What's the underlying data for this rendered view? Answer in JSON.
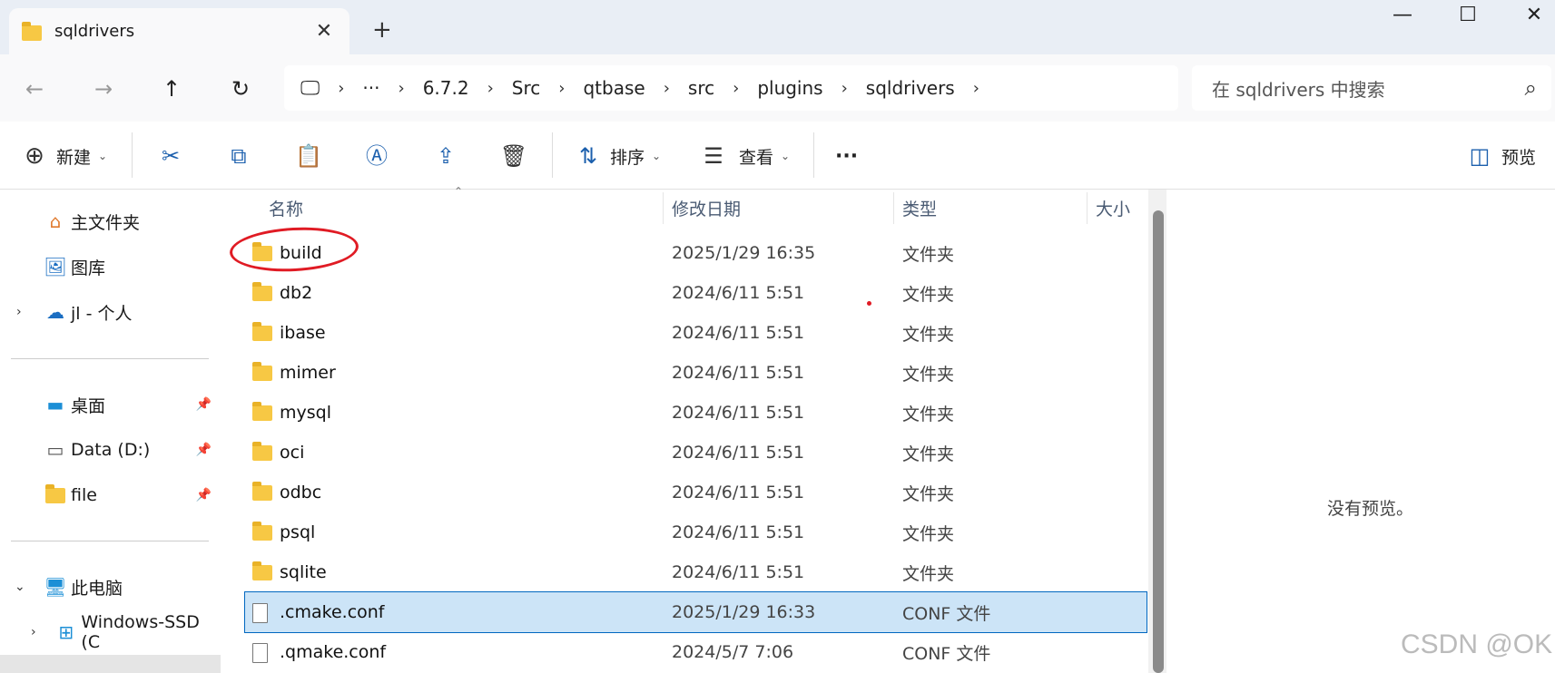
{
  "tab": {
    "title": "sqldrivers",
    "close": "✕",
    "new": "+"
  },
  "window": {
    "minimize": "—",
    "maximize": "☐",
    "close": "✕"
  },
  "nav": {
    "back": "←",
    "forward": "→",
    "up": "↑",
    "refresh": "↻"
  },
  "address": {
    "root_icon": "🖵",
    "ellipsis": "···",
    "sep": "›",
    "crumbs": [
      "6.7.2",
      "Src",
      "qtbase",
      "src",
      "plugins",
      "sqldrivers"
    ]
  },
  "search": {
    "placeholder": "在 sqldrivers 中搜索",
    "icon": "⌕"
  },
  "toolbar": {
    "new_label": "新建",
    "sort_label": "排序",
    "view_label": "查看",
    "more": "···",
    "preview_label": "预览"
  },
  "sidebar": {
    "items": [
      {
        "label": "主文件夹",
        "icon": "home-icon"
      },
      {
        "label": "图库",
        "icon": "gallery-icon"
      },
      {
        "label": "jl - 个人",
        "icon": "cloud-icon"
      },
      {
        "label": "桌面",
        "icon": "desktop-icon"
      },
      {
        "label": "Data (D:)",
        "icon": "drive-icon"
      },
      {
        "label": "file",
        "icon": "folder-icon"
      },
      {
        "label": "此电脑",
        "icon": "computer-icon"
      },
      {
        "label": "Windows-SSD (C",
        "icon": "windows-drive-icon"
      }
    ]
  },
  "columns": {
    "name": "名称",
    "date": "修改日期",
    "type": "类型",
    "size": "大小"
  },
  "files": [
    {
      "name": "build",
      "date": "2025/1/29 16:35",
      "type": "文件夹",
      "kind": "folder"
    },
    {
      "name": "db2",
      "date": "2024/6/11 5:51",
      "type": "文件夹",
      "kind": "folder"
    },
    {
      "name": "ibase",
      "date": "2024/6/11 5:51",
      "type": "文件夹",
      "kind": "folder"
    },
    {
      "name": "mimer",
      "date": "2024/6/11 5:51",
      "type": "文件夹",
      "kind": "folder"
    },
    {
      "name": "mysql",
      "date": "2024/6/11 5:51",
      "type": "文件夹",
      "kind": "folder"
    },
    {
      "name": "oci",
      "date": "2024/6/11 5:51",
      "type": "文件夹",
      "kind": "folder"
    },
    {
      "name": "odbc",
      "date": "2024/6/11 5:51",
      "type": "文件夹",
      "kind": "folder"
    },
    {
      "name": "psql",
      "date": "2024/6/11 5:51",
      "type": "文件夹",
      "kind": "folder"
    },
    {
      "name": "sqlite",
      "date": "2024/6/11 5:51",
      "type": "文件夹",
      "kind": "folder"
    },
    {
      "name": ".cmake.conf",
      "date": "2025/1/29 16:33",
      "type": "CONF 文件",
      "kind": "file",
      "selected": true
    },
    {
      "name": ".qmake.conf",
      "date": "2024/5/7 7:06",
      "type": "CONF 文件",
      "kind": "file"
    }
  ],
  "preview": {
    "empty_text": "没有预览。"
  },
  "watermark": "CSDN @OK",
  "colors": {
    "selection": "#cce4f7",
    "accent": "#0067c0",
    "annotation": "#e01b24",
    "folder": "#f7c844"
  }
}
